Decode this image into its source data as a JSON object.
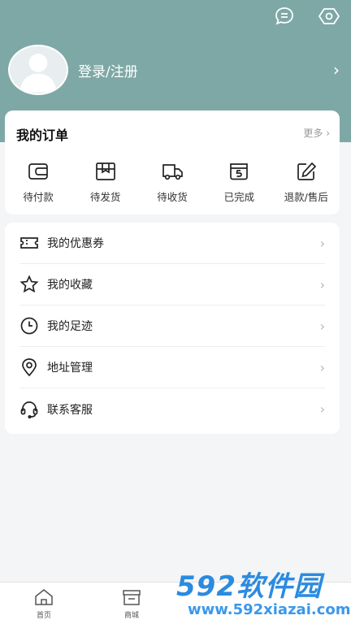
{
  "header": {
    "login_label": "登录/注册",
    "profile_chevron": "›"
  },
  "orders": {
    "title": "我的订单",
    "more_label": "更多 ›",
    "items": [
      {
        "label": "待付款",
        "icon": "wallet-icon"
      },
      {
        "label": "待发货",
        "icon": "package-icon"
      },
      {
        "label": "待收货",
        "icon": "truck-icon"
      },
      {
        "label": "已完成",
        "icon": "completed-box-icon"
      },
      {
        "label": "退款/售后",
        "icon": "edit-icon"
      }
    ]
  },
  "menu": {
    "items": [
      {
        "label": "我的优惠券",
        "icon": "coupon-icon"
      },
      {
        "label": "我的收藏",
        "icon": "star-icon"
      },
      {
        "label": "我的足迹",
        "icon": "clock-icon"
      },
      {
        "label": "地址管理",
        "icon": "location-pin-icon"
      },
      {
        "label": "联系客服",
        "icon": "headset-icon"
      }
    ],
    "chevron": "›"
  },
  "tabbar": {
    "items": [
      {
        "label": "首页",
        "icon": "home-icon"
      },
      {
        "label": "商城",
        "icon": "store-icon"
      }
    ]
  },
  "watermark": {
    "logo": "592软件园",
    "url": "www.592xiazai.com"
  },
  "colors": {
    "header": "#7ea8a6",
    "background": "#f3f5f6",
    "watermark": "#2b8be0"
  }
}
